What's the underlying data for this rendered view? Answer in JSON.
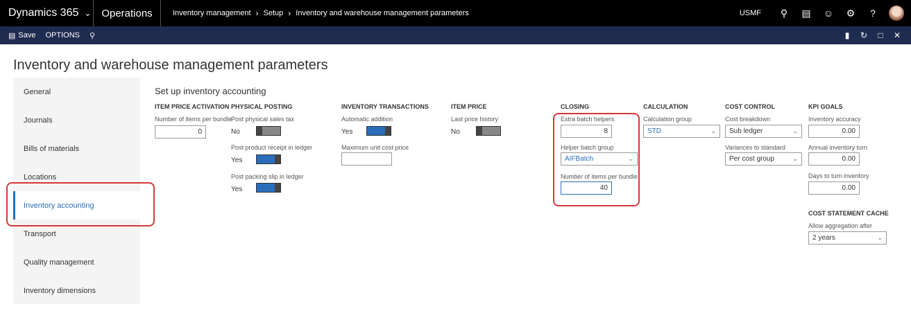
{
  "topbar": {
    "brand": "Dynamics 365",
    "module": "Operations",
    "breadcrumb": [
      "Inventory management",
      "Setup",
      "Inventory and warehouse management parameters"
    ],
    "company": "USMF"
  },
  "actionbar": {
    "save": "Save",
    "options": "OPTIONS"
  },
  "page": {
    "title": "Inventory and warehouse management parameters",
    "section_title": "Set up inventory accounting"
  },
  "nav": [
    "General",
    "Journals",
    "Bills of materials",
    "Locations",
    "Inventory accounting",
    "Transport",
    "Quality management",
    "Inventory dimensions"
  ],
  "item_price_activation": {
    "group": "ITEM PRICE ACTIVATION",
    "items_per_bundle_label": "Number of items per bundle",
    "items_per_bundle_value": "0"
  },
  "physical_posting": {
    "group": "PHYSICAL POSTING",
    "sales_tax_label": "Post physical sales tax",
    "sales_tax_value": "No",
    "product_receipt_label": "Post product receipt in ledger",
    "product_receipt_value": "Yes",
    "packing_slip_label": "Post packing slip in ledger",
    "packing_slip_value": "Yes"
  },
  "inventory_transactions": {
    "group": "INVENTORY TRANSACTIONS",
    "auto_add_label": "Automatic addition",
    "auto_add_value": "Yes",
    "max_unit_cost_label": "Maximum unit cost price",
    "max_unit_cost_value": ""
  },
  "item_price": {
    "group": "ITEM PRICE",
    "last_price_history_label": "Last price history",
    "last_price_history_value": "No"
  },
  "closing": {
    "group": "CLOSING",
    "extra_batch_label": "Extra batch helpers",
    "extra_batch_value": "8",
    "helper_group_label": "Helper batch group",
    "helper_group_value": "AIFBatch",
    "items_per_bundle_label": "Number of items per bundle",
    "items_per_bundle_value": "40"
  },
  "calculation": {
    "group": "CALCULATION",
    "calc_group_label": "Calculation group",
    "calc_group_value": "STD"
  },
  "cost_control": {
    "group": "COST CONTROL",
    "breakdown_label": "Cost breakdown",
    "breakdown_value": "Sub ledger",
    "variances_label": "Variances to standard",
    "variances_value": "Per cost group"
  },
  "kpi_goals": {
    "group": "KPI GOALS",
    "accuracy_label": "Inventory accuracy",
    "accuracy_value": "0.00",
    "turn_label": "Annual inventory turn",
    "turn_value": "0.00",
    "days_label": "Days to turn inventory",
    "days_value": "0.00"
  },
  "cost_statement_cache": {
    "group": "COST STATEMENT CACHE",
    "aggregation_label": "Allow aggregation after",
    "aggregation_value": "2 years"
  },
  "colors": {
    "topbar": "#000000",
    "actionbar": "#1f2b4f",
    "accent": "#2a6ebb",
    "highlight": "#d8363a"
  }
}
